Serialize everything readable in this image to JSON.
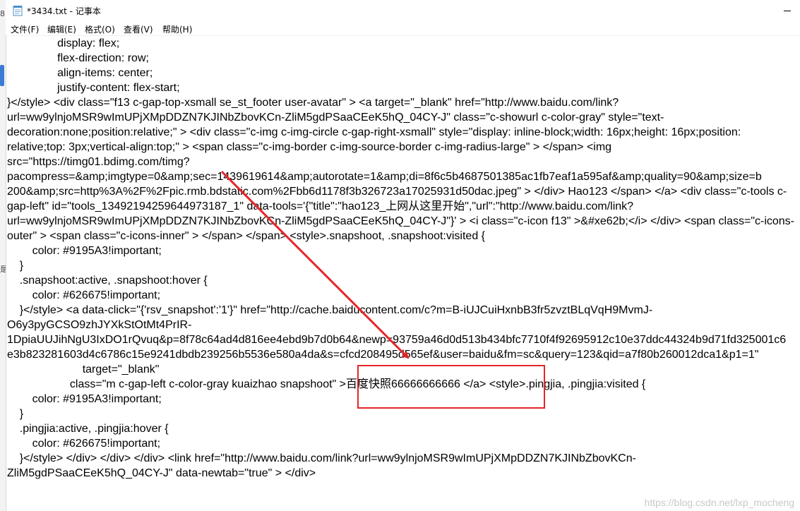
{
  "window": {
    "title": "*3434.txt - 记事本"
  },
  "menu": [
    "文件(F)",
    "编辑(E)",
    "格式(O)",
    "查看(V)",
    "帮助(H)"
  ],
  "left_strip_glyphs": [
    "8",
    "是"
  ],
  "editor": {
    "lines": [
      "                display: flex;",
      "                flex-direction: row;",
      "                align-items: center;",
      "                justify-content: flex-start;",
      "}</style> <div class=\"f13 c-gap-top-xsmall se_st_footer user-avatar\" > <a target=\"_blank\" href=\"http://www.baidu.com/link?",
      "url=ww9ylnjoMSR9wImUPjXMpDDZN7KJINbZbovKCn-ZliM5gdPSaaCEeK5hQ_04CY-J\" class=\"c-showurl c-color-gray\" style=\"text-",
      "decoration:none;position:relative;\" > <div class=\"c-img c-img-circle c-gap-right-xsmall\" style=\"display: inline-block;width: 16px;height: 16px;position:",
      "relative;top: 3px;vertical-align:top;\" > <span class=\"c-img-border c-img-source-border c-img-radius-large\" > </span> <img",
      "src=\"https://timg01.bdimg.com/timg?",
      "pacompress=&amp;imgtype=0&amp;sec=1439619614&amp;autorotate=1&amp;di=8f6c5b4687501385ac1fb7eaf1a595af&amp;quality=90&amp;size=b",
      "200&amp;src=http%3A%2F%2Fpic.rmb.bdstatic.com%2Fbb6d1178f3b326723a17025931d50dac.jpeg\" > </div> Hao123 </span> </a> <div class=\"c-tools c-",
      "gap-left\" id=\"tools_13492194259644973187_1\" data-tools='{\"title\":\"hao123_上网从这里开始\",\"url\":\"http://www.baidu.com/link?",
      "url=ww9ylnjoMSR9wImUPjXMpDDZN7KJINbZbovKCn-ZliM5gdPSaaCEeK5hQ_04CY-J\"}' > <i class=\"c-icon f13\" >&#xe62b;</i> </div> <span class=\"c-icons-",
      "outer\" > <span class=\"c-icons-inner\" > </span> </span> <style>.snapshoot, .snapshoot:visited {",
      "        color: #9195A3!important;",
      "    }",
      "    .snapshoot:active, .snapshoot:hover {",
      "        color: #626675!important;",
      "    }</style> <a data-click=\"{'rsv_snapshot':'1'}\" href=\"http://cache.baiducontent.com/c?m=B-iUJCuiHxnbB3fr5zvztBLqVqH9MvmJ-",
      "O6y3pyGCSO9zhJYXkStOtMt4PrIR-",
      "1DpiaUUJihNgU3IxDO1rQvuq&p=8f78c64ad4d816ee4ebd9b7d0b64&newp=93759a46d0d513b434bfc7710f4f92695912c10e37ddc44324b9d71fd325001c6",
      "e3b823281603d4c6786c15e9241dbdb239256b5536e580a4da&s=cfcd208495d565ef&user=baidu&fm=sc&query=123&qid=a7f80b260012dca1&p1=1\"",
      "                        target=\"_blank\"",
      "                    class=\"m c-gap-left c-color-gray kuaizhao snapshoot\" >百度快照66666666666 </a> <style>.pingjia, .pingjia:visited {",
      "        color: #9195A3!important;",
      "    }",
      "    .pingjia:active, .pingjia:hover {",
      "        color: #626675!important;",
      "    }</style> </div> </div> </div> <link href=\"http://www.baidu.com/link?url=ww9ylnjoMSR9wImUPjXMpDDZN7KJINbZbovKCn-",
      "ZliM5gdPSaaCEeK5hQ_04CY-J\" data-newtab=\"true\" > </div>"
    ]
  },
  "annotation": {
    "color": "#e5252a"
  },
  "watermark": "https://blog.csdn.net/lxp_mocheng"
}
